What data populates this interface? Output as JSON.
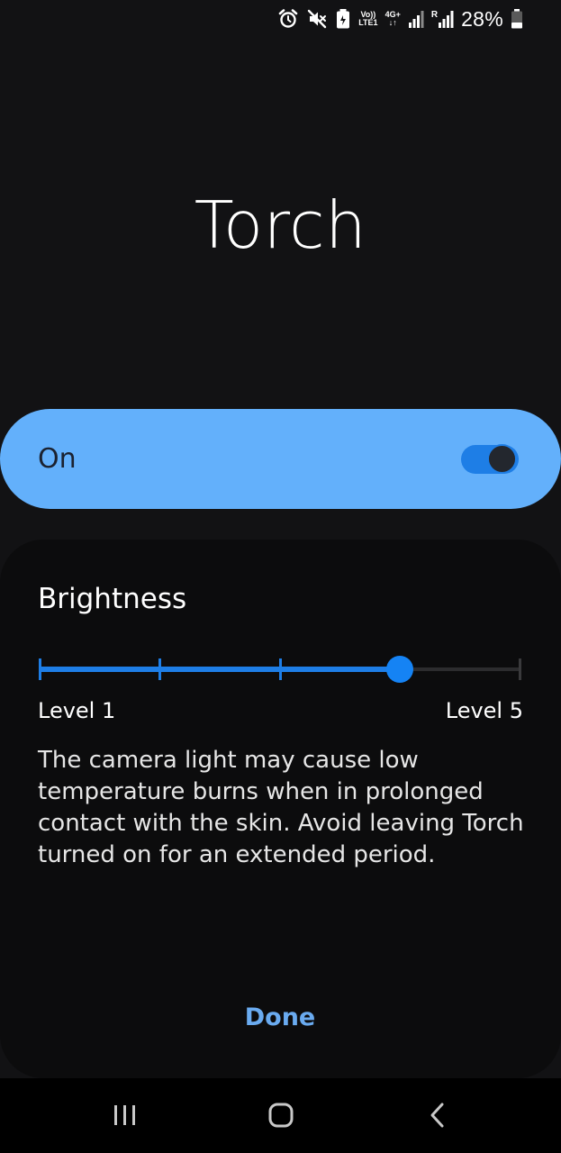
{
  "status_bar": {
    "icons": [
      "alarm-icon",
      "mute-icon",
      "battery-saver-icon",
      "volte-icon",
      "4g-data-icon",
      "signal-icon",
      "roaming-signal-icon",
      "battery-icon"
    ],
    "volte_line1": "Vo))",
    "volte_line2": "LTE1",
    "network_line1": "4G+",
    "roaming_label": "R",
    "battery_percent": "28%"
  },
  "title": "Torch",
  "switch": {
    "label": "On",
    "state": "on"
  },
  "brightness": {
    "heading": "Brightness",
    "min_label": "Level 1",
    "max_label": "Level 5",
    "level": 4,
    "levels": 5
  },
  "warning_text": "The camera light may cause low temperature burns when in prolonged contact with the skin. Avoid leaving Torch turned on for an extended period.",
  "done_label": "Done",
  "nav_bar": {
    "items": [
      "recent-apps-icon",
      "home-icon",
      "back-icon"
    ]
  },
  "colors": {
    "background": "#121214",
    "panel": "#0c0c0d",
    "switch_bar": "#63b0fb",
    "accent": "#1e7ee6",
    "done": "#6aabf0"
  }
}
